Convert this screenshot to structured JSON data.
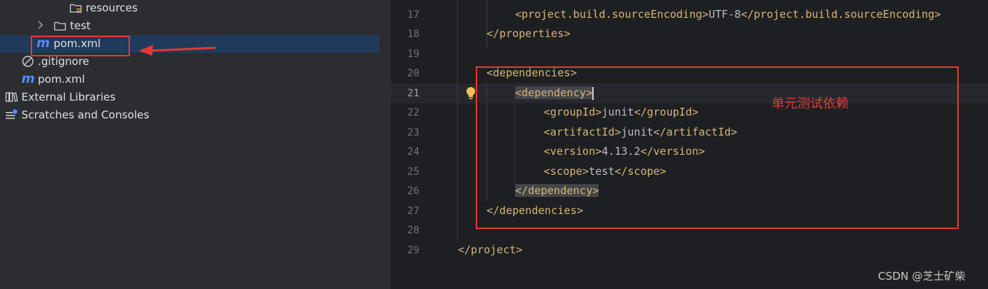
{
  "project_tree": {
    "items": [
      {
        "label": "resources",
        "icon": "resources-folder-icon"
      },
      {
        "label": "test",
        "icon": "folder-icon"
      },
      {
        "label": "pom.xml",
        "icon": "maven-icon",
        "selected": true
      },
      {
        "label": ".gitignore",
        "icon": "ignore-file-icon"
      },
      {
        "label": "pom.xml",
        "icon": "maven-icon"
      },
      {
        "label": "External Libraries",
        "icon": "libraries-icon"
      },
      {
        "label": "Scratches and Consoles",
        "icon": "scratches-icon"
      }
    ]
  },
  "editor": {
    "line_numbers": [
      "17",
      "18",
      "19",
      "20",
      "21",
      "22",
      "23",
      "24",
      "25",
      "26",
      "27",
      "28",
      "29"
    ],
    "current_line": "21",
    "lines": {
      "l17": {
        "open": "<project.build.sourceEncoding>",
        "text": "UTF-8",
        "close": "</project.build.sourceEncoding>"
      },
      "l18": {
        "tag": "</properties>"
      },
      "l20": {
        "tag": "<dependencies>"
      },
      "l21": {
        "open": "<dependency",
        "close": ">"
      },
      "l22": {
        "open": "<groupId>",
        "text": "junit",
        "close": "</groupId>"
      },
      "l23": {
        "open": "<artifactId>",
        "text": "junit",
        "close": "</artifactId>"
      },
      "l24": {
        "open": "<version>",
        "text": "4.13.2",
        "close": "</version>"
      },
      "l25": {
        "open": "<scope>",
        "text": "test",
        "close": "</scope>"
      },
      "l26": {
        "tag": "</dependency>"
      },
      "l27": {
        "tag": "</dependencies>"
      },
      "l29": {
        "tag": "</project>"
      }
    }
  },
  "annotation": {
    "text": "单元测试依赖",
    "color": "#e53935"
  },
  "watermark": {
    "text": "CSDN @芝士矿柴"
  },
  "colors": {
    "tag": "#d5b778",
    "text": "#bcbec4",
    "selection": "#1f3a5a",
    "annotation_red": "#e53935"
  }
}
